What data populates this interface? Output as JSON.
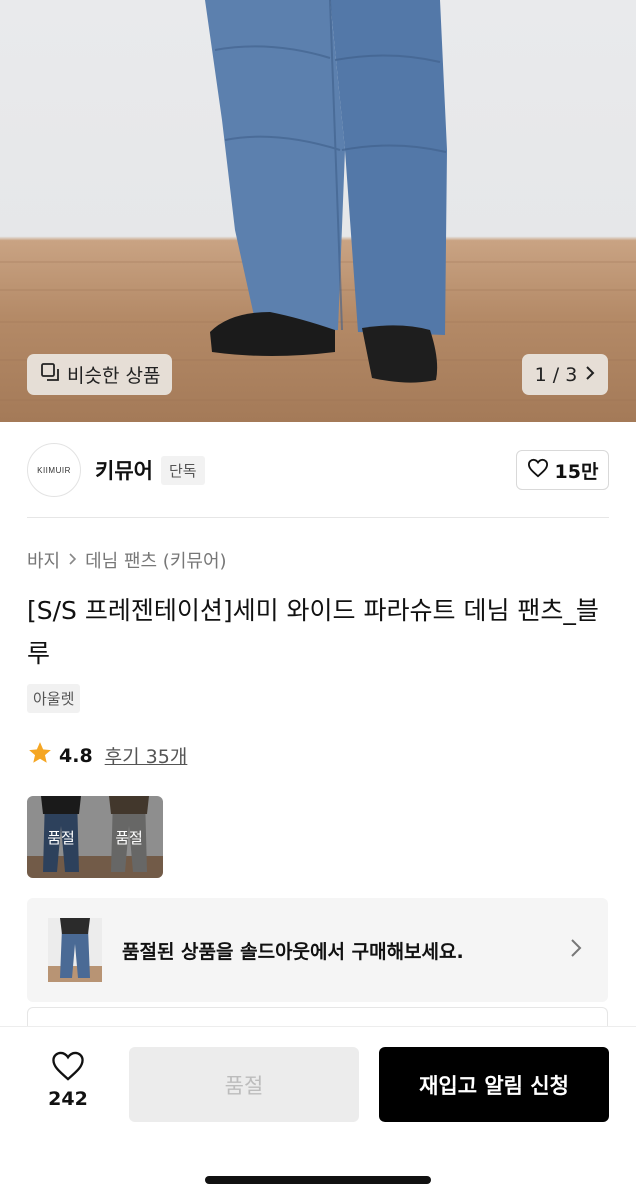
{
  "hero": {
    "similar_label": "비슷한 상품",
    "counter": "1 / 3"
  },
  "brand": {
    "logo_text": "KIIMUIR",
    "name": "키뮤어",
    "tag": "단독",
    "likes": "15만"
  },
  "product": {
    "breadcrumb": [
      "바지",
      "데님 팬츠 (키뮤어)"
    ],
    "title": "[S/S 프레젠테이션]세미 와이드 파라슈트 데님 팬츠_블루",
    "tag": "아울렛",
    "rating": "4.8",
    "reviews": "후기 35개"
  },
  "color_options": [
    {
      "label": "품절",
      "color": "#4a6a95"
    },
    {
      "label": "품절",
      "color": "#a7a7a5"
    }
  ],
  "soldout_banner": {
    "text": "품절된 상품을 솔드아웃에서 구매해보세요."
  },
  "bottom_bar": {
    "wish_count": "242",
    "soldout_label": "품절",
    "restock_label": "재입고 알림 신청"
  },
  "colors": {
    "accent_star": "#f5a623",
    "primary_button": "#000000",
    "disabled_button": "#ececec"
  }
}
